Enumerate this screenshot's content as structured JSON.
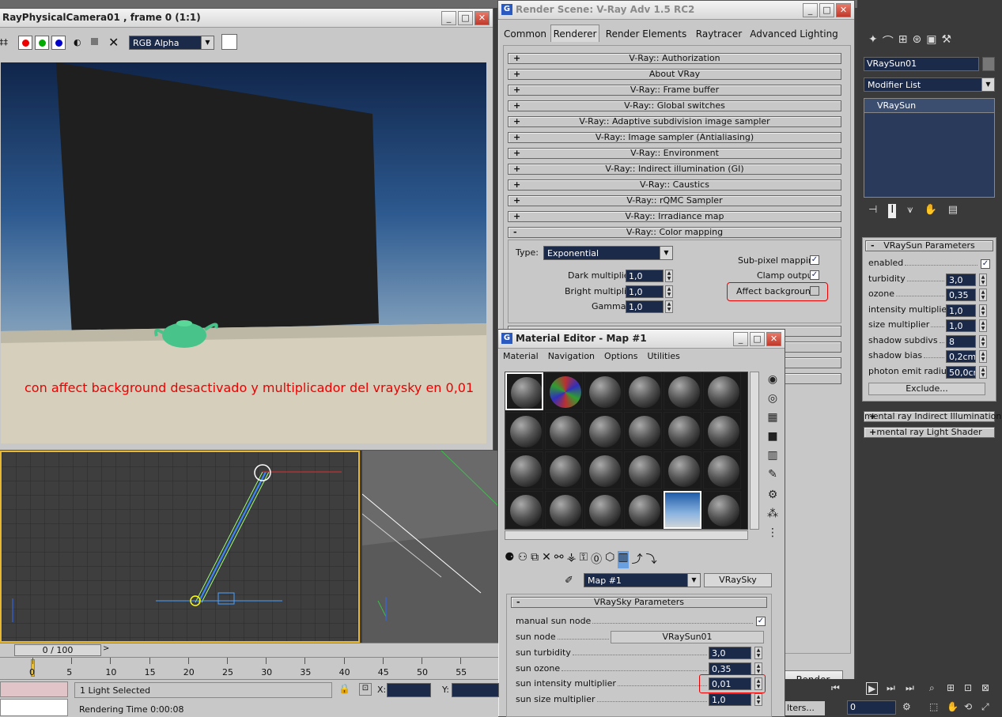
{
  "viewer": {
    "title": "RayPhysicalCamera01 , frame 0 (1:1)",
    "channel": "RGB Alpha",
    "caption": "con affect background desactivado y multiplicador del vraysky en 0,01"
  },
  "render_scene": {
    "title": "Render Scene: V-Ray Adv 1.5 RC2",
    "tabs": [
      "Common",
      "Renderer",
      "Render Elements",
      "Raytracer",
      "Advanced Lighting"
    ],
    "rollouts": [
      "V-Ray:: Authorization",
      "About VRay",
      "V-Ray:: Frame buffer",
      "V-Ray:: Global switches",
      "V-Ray:: Adaptive subdivision image sampler",
      "V-Ray:: Image sampler (Antialiasing)",
      "V-Ray:: Environment",
      "V-Ray:: Indirect illumination (GI)",
      "V-Ray:: Caustics",
      "V-Ray:: rQMC Sampler",
      "V-Ray:: Irradiance map"
    ],
    "color_mapping": {
      "title": "V-Ray:: Color mapping",
      "type_label": "Type:",
      "type_value": "Exponential",
      "dark_label": "Dark multiplier:",
      "dark_value": "1,0",
      "bright_label": "Bright multiplier:",
      "bright_value": "1,0",
      "gamma_label": "Gamma:",
      "gamma_value": "1,0",
      "subpixel_label": "Sub-pixel mapping",
      "clamp_label": "Clamp output",
      "affect_label": "Affect background"
    },
    "render_button": "Render"
  },
  "material_editor": {
    "title": "Material Editor - Map #1",
    "menu": [
      "Material",
      "Navigation",
      "Options",
      "Utilities"
    ],
    "map_name": "Map #1",
    "map_type": "VRaySky",
    "sky": {
      "title": "VRaySky Parameters",
      "manual_label": "manual sun node",
      "sun_node_label": "sun node",
      "sun_node_value": "VRaySun01",
      "turb_label": "sun turbidity",
      "turb_value": "3,0",
      "ozone_label": "sun ozone",
      "ozone_value": "0,35",
      "int_label": "sun intensity multiplier",
      "int_value": "0,01",
      "size_label": "sun size multiplier",
      "size_value": "1,0"
    }
  },
  "command_panel": {
    "object_name": "VRaySun01",
    "modifier_list": "Modifier List",
    "stack_item": "VRaySun",
    "sun_params": {
      "title": "VRaySun Parameters",
      "rows": [
        {
          "label": "enabled",
          "value": ""
        },
        {
          "label": "turbidity",
          "value": "3,0"
        },
        {
          "label": "ozone",
          "value": "0,35"
        },
        {
          "label": "intensity multiplier",
          "value": "1,0"
        },
        {
          "label": "size multiplier",
          "value": "1,0"
        },
        {
          "label": "shadow subdivs",
          "value": "8"
        },
        {
          "label": "shadow bias",
          "value": "0,2cm"
        },
        {
          "label": "photon emit radius",
          "value": "50,0cm"
        }
      ],
      "exclude": "Exclude..."
    },
    "mr_indirect": "mental ray Indirect Illumination",
    "mr_shader": "mental ray Light Shader"
  },
  "status": {
    "frame_counter": "0 / 100",
    "ticks": [
      "0",
      "5",
      "10",
      "15",
      "20",
      "25",
      "30",
      "35",
      "40",
      "45",
      "50",
      "55"
    ],
    "lights": "1 Light Selected",
    "render_time": "Rendering Time  0:00:08",
    "x_label": "X:",
    "y_label": "Y:",
    "frame_field": "0",
    "filters": "lters..."
  }
}
